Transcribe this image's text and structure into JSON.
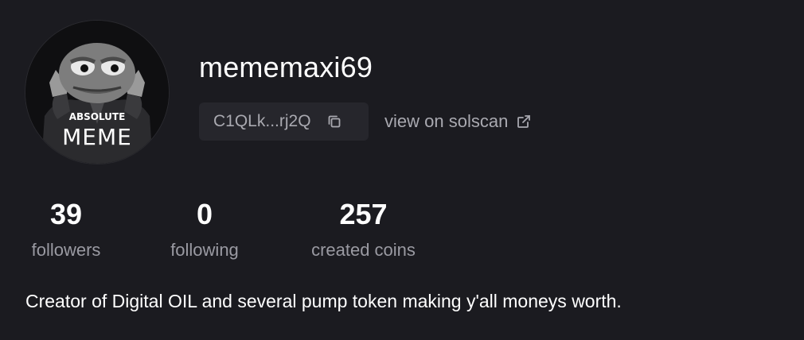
{
  "profile": {
    "avatar_caption_small": "ABSOLUTE",
    "avatar_caption_big": "MEME",
    "username": "mememaxi69",
    "address_short": "C1QLk...rj2Q",
    "solscan_link": "view on solscan",
    "bio": "Creator of Digital OIL and several pump token making y'all moneys worth."
  },
  "stats": {
    "followers": {
      "value": "39",
      "label": "followers"
    },
    "following": {
      "value": "0",
      "label": "following"
    },
    "created_coins": {
      "value": "257",
      "label": "created coins"
    }
  },
  "icons": {
    "copy": "copy-icon",
    "external": "external-link-icon"
  },
  "colors": {
    "background": "#1b1b20",
    "chip_background": "#26262c",
    "muted_text": "#a9a9b0"
  }
}
